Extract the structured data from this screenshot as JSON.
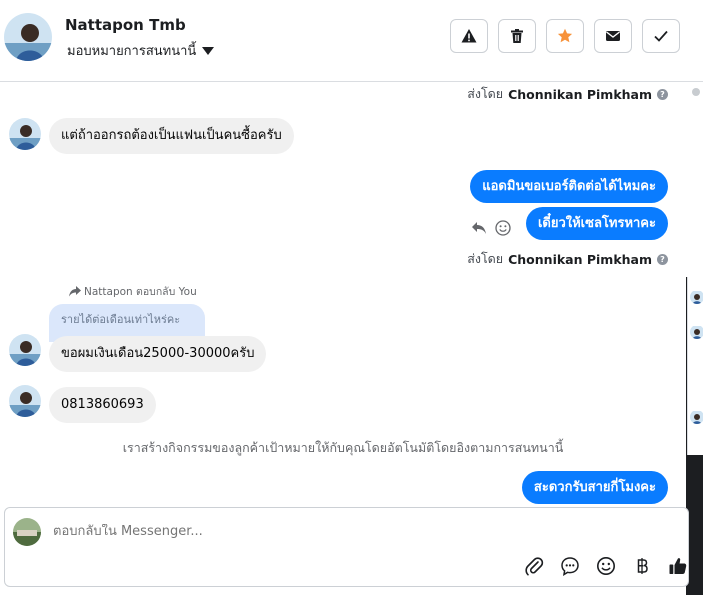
{
  "header": {
    "contact_name": "Nattapon Tmb",
    "assign_label": "มอบหมายการสนทนานี้",
    "actions": [
      {
        "name": "report-button",
        "icon": "warning-icon"
      },
      {
        "name": "delete-button",
        "icon": "trash-icon"
      },
      {
        "name": "star-button",
        "icon": "star-icon"
      },
      {
        "name": "mark-unread-button",
        "icon": "envelope-icon"
      },
      {
        "name": "mark-done-button",
        "icon": "check-icon"
      }
    ]
  },
  "messages": {
    "sent_by_prefix": "ส่งโดย",
    "sent_by_name": "Chonnikan Pimkham",
    "in_1": "แต่ถ้าออกรถต้องเป็นแฟนเป็นคนซื้อครับ",
    "out_1": "แอดมินขอเบอร์ติดต่อได้ไหมคะ",
    "out_2": "เดี๋ยวให้เซลโทรหาคะ",
    "reply_label": "Nattapon ตอบกลับ You",
    "quoted": "รายได้ต่อเดือนเท่าไหร่คะ",
    "in_2": "ขอผมเงินเดือน25000-30000ครับ",
    "in_3": "0813860693",
    "system_note": "เราสร้างกิจกรรมของลูกค้าเป้าหมายให้กับคุณโดยอัตโนมัติโดยอิงตามการสนทนานี้",
    "out_3": "สะดวกรับสายกี่โมงคะ"
  },
  "composer": {
    "placeholder": "ตอบกลับใน Messenger...",
    "icons": [
      "paperclip-icon",
      "saved-reply-icon",
      "emoji-icon",
      "baht-icon",
      "like-icon"
    ]
  },
  "colors": {
    "accent": "#0a7cff",
    "star": "#f7923a",
    "incoming_bubble": "#f0f0f0",
    "quote_bg": "#dbe7fb"
  }
}
